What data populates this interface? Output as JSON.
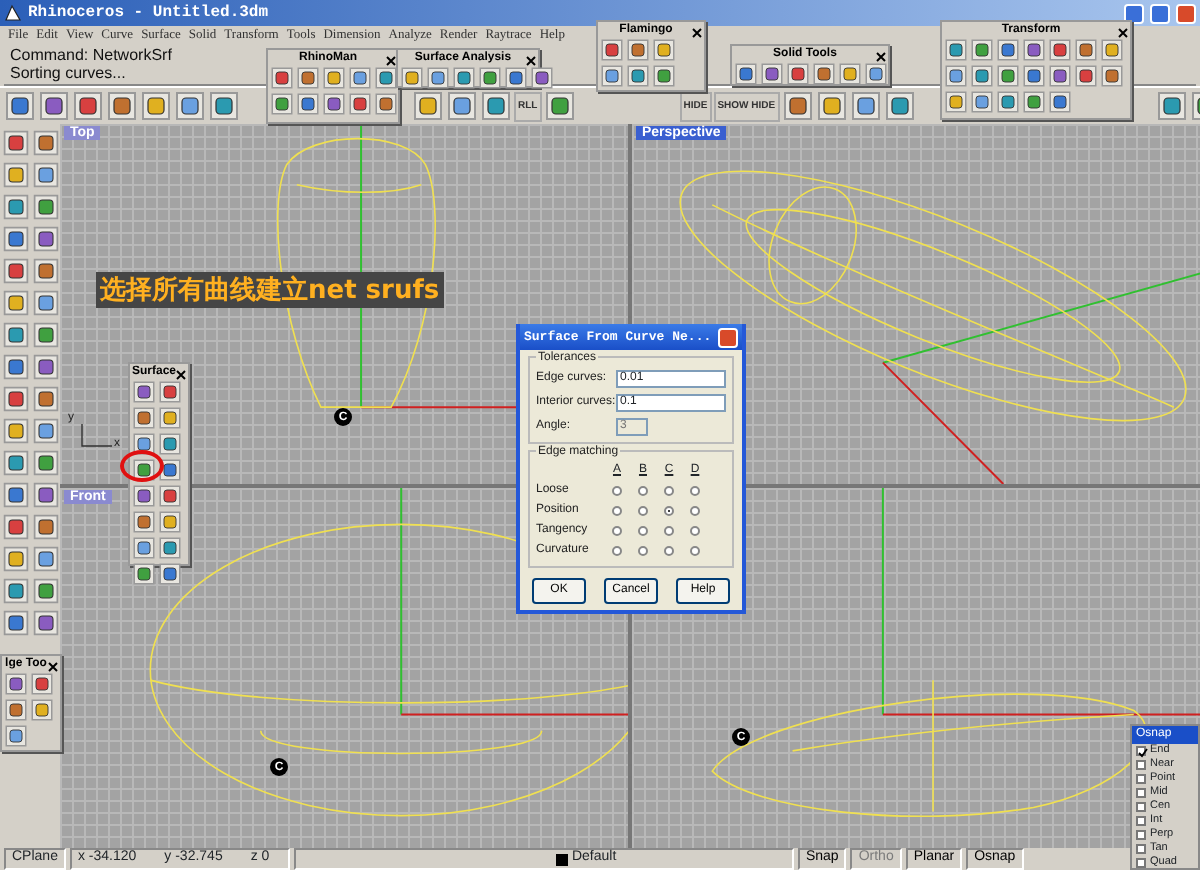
{
  "window": {
    "title": "Rhinoceros - Untitled.3dm"
  },
  "menu": [
    "File",
    "Edit",
    "View",
    "Curve",
    "Surface",
    "Solid",
    "Transform",
    "Tools",
    "Dimension",
    "Analyze",
    "Render",
    "Raytrace",
    "Help"
  ],
  "command_area": {
    "lines": [
      "Command: NetworkSrf",
      "Sorting curves..."
    ]
  },
  "main_toolbar": {
    "text_buttons": [
      "RLL",
      "HIDE",
      "SHOW HIDE"
    ]
  },
  "floating_toolbars": [
    {
      "title": "RhinoMan"
    },
    {
      "title": "Surface Analysis"
    },
    {
      "title": "Flamingo"
    },
    {
      "title": "Solid Tools"
    },
    {
      "title": "Transform"
    },
    {
      "title": "Surface"
    },
    {
      "title": "lge Too"
    }
  ],
  "viewports": [
    {
      "label": "Top",
      "active": false,
      "note": "选择所有曲线建立net srufs",
      "markers": [
        "C"
      ],
      "axis_letters": [
        "y",
        "x"
      ]
    },
    {
      "label": "Perspective",
      "active": true
    },
    {
      "label": "Front",
      "active": false,
      "markers": [
        "C"
      ]
    },
    {
      "markers": [
        "C"
      ]
    }
  ],
  "dialog": {
    "title": "Surface From Curve Ne...",
    "tolerances": {
      "title": "Tolerances",
      "fields": [
        {
          "label": "Edge curves:",
          "value": "0.01",
          "disabled": false
        },
        {
          "label": "Interior curves:",
          "value": "0.1",
          "disabled": false
        },
        {
          "label": "Angle:",
          "value": "3",
          "disabled": true
        }
      ]
    },
    "edge_matching": {
      "title": "Edge matching",
      "columns": [
        "A",
        "B",
        "C",
        "D"
      ],
      "rows": [
        {
          "label": "Loose",
          "selected": [
            false,
            false,
            false,
            false
          ]
        },
        {
          "label": "Position",
          "selected": [
            false,
            false,
            true,
            false
          ]
        },
        {
          "label": "Tangency",
          "selected": [
            false,
            false,
            false,
            false
          ]
        },
        {
          "label": "Curvature",
          "selected": [
            false,
            false,
            false,
            false
          ]
        }
      ]
    },
    "buttons": [
      "OK",
      "Cancel",
      "Help"
    ]
  },
  "osnap": {
    "title": "Osnap",
    "items": [
      {
        "label": "End",
        "checked": true
      },
      {
        "label": "Near",
        "checked": false
      },
      {
        "label": "Point",
        "checked": false
      },
      {
        "label": "Mid",
        "checked": false
      },
      {
        "label": "Cen",
        "checked": false
      },
      {
        "label": "Int",
        "checked": false
      },
      {
        "label": "Perp",
        "checked": false
      },
      {
        "label": "Tan",
        "checked": false
      },
      {
        "label": "Quad",
        "checked": false
      }
    ]
  },
  "status_bar": {
    "cplane": "CPlane",
    "x": "x -34.120",
    "y": "y -32.745",
    "z": "z 0",
    "layer": "Default",
    "toggles": [
      {
        "label": "Snap",
        "enabled": true
      },
      {
        "label": "Ortho",
        "enabled": false
      },
      {
        "label": "Planar",
        "enabled": true
      },
      {
        "label": "Osnap",
        "enabled": true
      }
    ]
  }
}
